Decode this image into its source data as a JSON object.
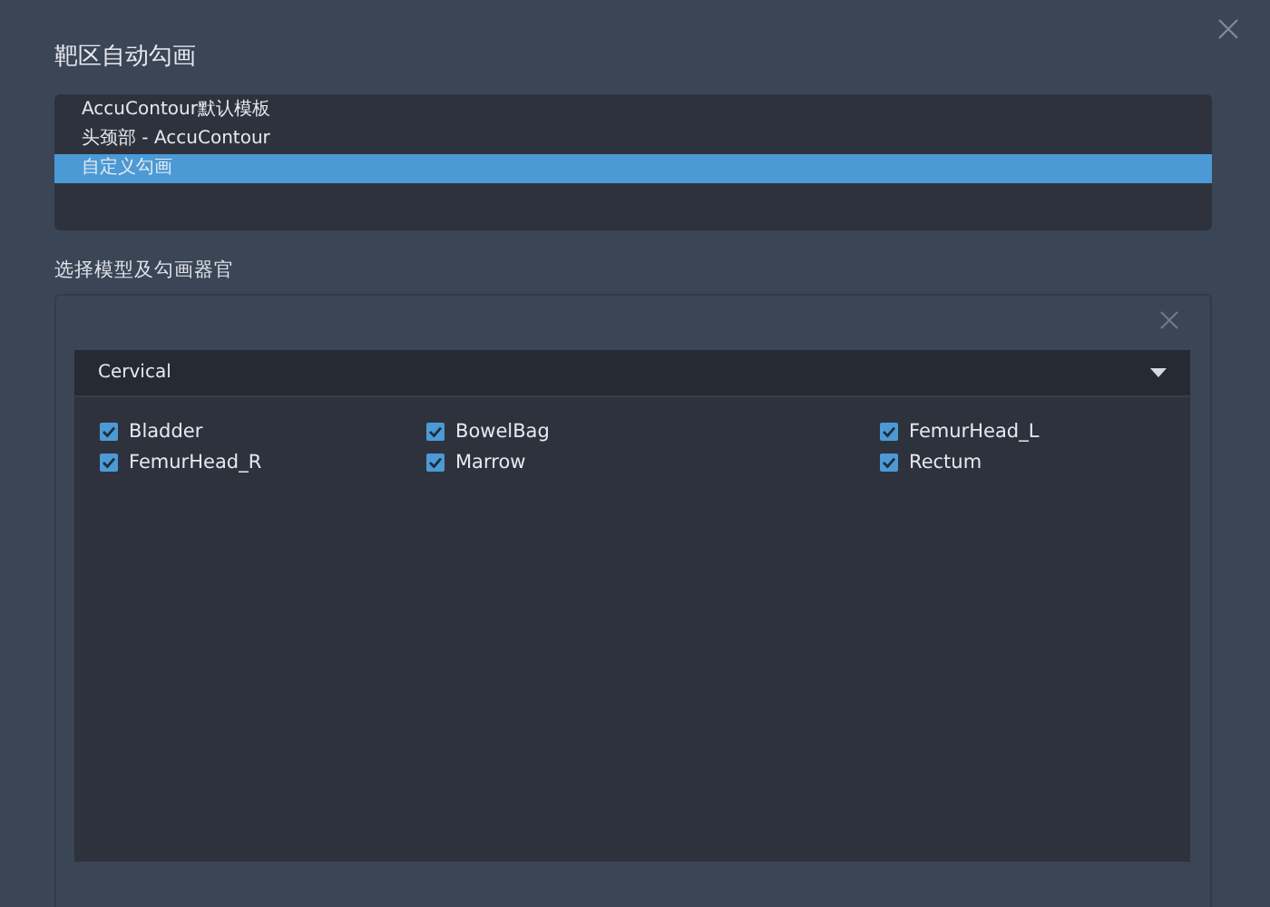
{
  "dialog": {
    "title": "靶区自动勾画"
  },
  "templates": [
    {
      "label": "AccuContour默认模板",
      "selected": false
    },
    {
      "label": "头颈部 - AccuContour",
      "selected": false
    },
    {
      "label": "自定义勾画",
      "selected": true
    }
  ],
  "section_label": "选择模型及勾画器官",
  "model_select": {
    "value": "Cervical"
  },
  "organs": [
    {
      "label": "Bladder",
      "checked": true
    },
    {
      "label": "BowelBag",
      "checked": true
    },
    {
      "label": "FemurHead_L",
      "checked": true
    },
    {
      "label": "FemurHead_R",
      "checked": true
    },
    {
      "label": "Marrow",
      "checked": true
    },
    {
      "label": "Rectum",
      "checked": true
    }
  ]
}
